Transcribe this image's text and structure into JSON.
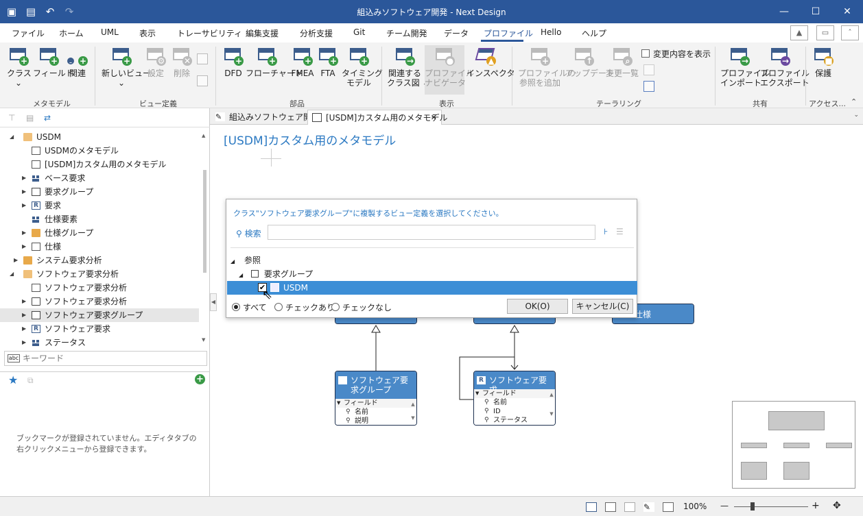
{
  "window": {
    "title": "組込みソフトウェア開発 - Next Design",
    "controls": {
      "minimize": "—",
      "maximize": "☐",
      "close": "✕"
    }
  },
  "menu": {
    "items": [
      "ファイル",
      "ホーム",
      "UML",
      "表示",
      "トレーサビリティ",
      "編集支援",
      "分析支援",
      "Git",
      "チーム開発",
      "データ",
      "プロファイル",
      "Hello",
      "ヘルプ"
    ],
    "active": "プロファイル"
  },
  "ribbon": {
    "metamodel": {
      "label": "メタモデル",
      "buttons": [
        {
          "label": "クラス",
          "sub": "⌄"
        },
        {
          "label": "フィールド"
        },
        {
          "label": "関連"
        }
      ]
    },
    "view_def": {
      "label": "ビュー定義",
      "buttons": [
        {
          "label": "新しいビュー",
          "sub": "⌄"
        },
        {
          "label": "設定"
        },
        {
          "label": "削除"
        }
      ]
    },
    "parts": {
      "label": "部品",
      "buttons": [
        {
          "label": "DFD"
        },
        {
          "label": "フローチャート"
        },
        {
          "label": "FMEA"
        },
        {
          "label": "FTA"
        },
        {
          "label": "タイミング",
          "sub": "モデル"
        }
      ]
    },
    "display": {
      "label": "表示",
      "buttons": [
        {
          "label": "関連する",
          "sub": "クラス図 ⌄"
        },
        {
          "label": "プロファイル",
          "sub": "ナビゲータ"
        },
        {
          "label": "インスペクタ"
        }
      ]
    },
    "tailoring": {
      "label": "テーラリング",
      "buttons": [
        {
          "label": "プロファイルの",
          "sub": "参照を追加"
        },
        {
          "label": "アップデート"
        },
        {
          "label": "変更一覧"
        }
      ],
      "checkbox": "変更内容を表示"
    },
    "share": {
      "label": "共有",
      "buttons": [
        {
          "label": "プロファイル",
          "sub": "インポート"
        },
        {
          "label": "プロファイル",
          "sub": "エクスポート"
        }
      ]
    },
    "access": {
      "label": "アクセス...",
      "buttons": [
        {
          "label": "保護"
        }
      ]
    }
  },
  "tree": {
    "rows": [
      {
        "label": "USDM",
        "arrow": "◢",
        "icon": "folder"
      },
      {
        "label": "USDMのメタモデル",
        "arrow": "",
        "icon": "diagram"
      },
      {
        "label": "[USDM]カスタム用のメタモデル",
        "arrow": "",
        "icon": "diagram"
      },
      {
        "label": "ベース要求",
        "arrow": "▶",
        "icon": "blocks"
      },
      {
        "label": "要求グループ",
        "arrow": "▶",
        "icon": "group"
      },
      {
        "label": "要求",
        "arrow": "▶",
        "icon": "r"
      },
      {
        "label": "仕様要素",
        "arrow": "",
        "icon": "blocks"
      },
      {
        "label": "仕様グループ",
        "arrow": "▶",
        "icon": "folder"
      },
      {
        "label": "仕様",
        "arrow": "▶",
        "icon": "doc"
      },
      {
        "label": "システム要求分析",
        "arrow": "▶",
        "icon": "folder"
      },
      {
        "label": "ソフトウェア要求分析",
        "arrow": "◢",
        "icon": "folder"
      },
      {
        "label": "ソフトウェア要求分析",
        "arrow": "",
        "icon": "diagram"
      },
      {
        "label": "ソフトウェア要求分析",
        "arrow": "▶",
        "icon": "folder"
      },
      {
        "label": "ソフトウェア要求グループ",
        "arrow": "▶",
        "icon": "group"
      },
      {
        "label": "ソフトウェア要求",
        "arrow": "▶",
        "icon": "r"
      },
      {
        "label": "ステータス",
        "arrow": "▶",
        "icon": "blocks"
      }
    ]
  },
  "keyword": {
    "placeholder": "キーワード",
    "icon_text": "abc"
  },
  "bookmarks": {
    "empty_message": "ブックマークが登録されていません。エディタタブの右クリックメニューから登録できます。"
  },
  "tabs": [
    {
      "label": "組込みソフトウェア開発"
    },
    {
      "label": "[USDM]カスタム用のメタモデル",
      "close": "✕"
    }
  ],
  "editor": {
    "title": "[USDM]カスタム用のメタモデル",
    "nodes": {
      "swgroup": {
        "title": "ソフトウェア要求グループ",
        "fields_header": "フィールド",
        "fields": [
          "名前",
          "説明"
        ]
      },
      "swreq": {
        "title": "ソフトウェア要求",
        "fields_header": "フィールド",
        "fields": [
          "名前",
          "ID",
          "ステータス"
        ]
      },
      "spec": {
        "title": "仕様"
      }
    }
  },
  "dialog": {
    "message": "クラス\"ソフトウェア要求グループ\"に複製するビュー定義を選択してください。",
    "search_label": "検索",
    "search_value": "",
    "tree": [
      {
        "label": "参照",
        "level": 0
      },
      {
        "label": "要求グループ",
        "level": 1
      },
      {
        "label": "USDM",
        "level": 2,
        "checked": true,
        "selected": true
      }
    ],
    "filters": [
      {
        "label": "すべて",
        "selected": true
      },
      {
        "label": "チェックあり"
      },
      {
        "label": "チェックなし"
      }
    ],
    "ok_label": "OK(O)",
    "cancel_label": "キャンセル(C)",
    "check_mark": "✔"
  },
  "status": {
    "zoom": "100%",
    "minus": "—",
    "plus": "+"
  },
  "colors": {
    "titlebar": "#2b579a",
    "accent": "#2b79c2",
    "node_header": "#4a89c8",
    "selection": "#3c8ed6"
  }
}
